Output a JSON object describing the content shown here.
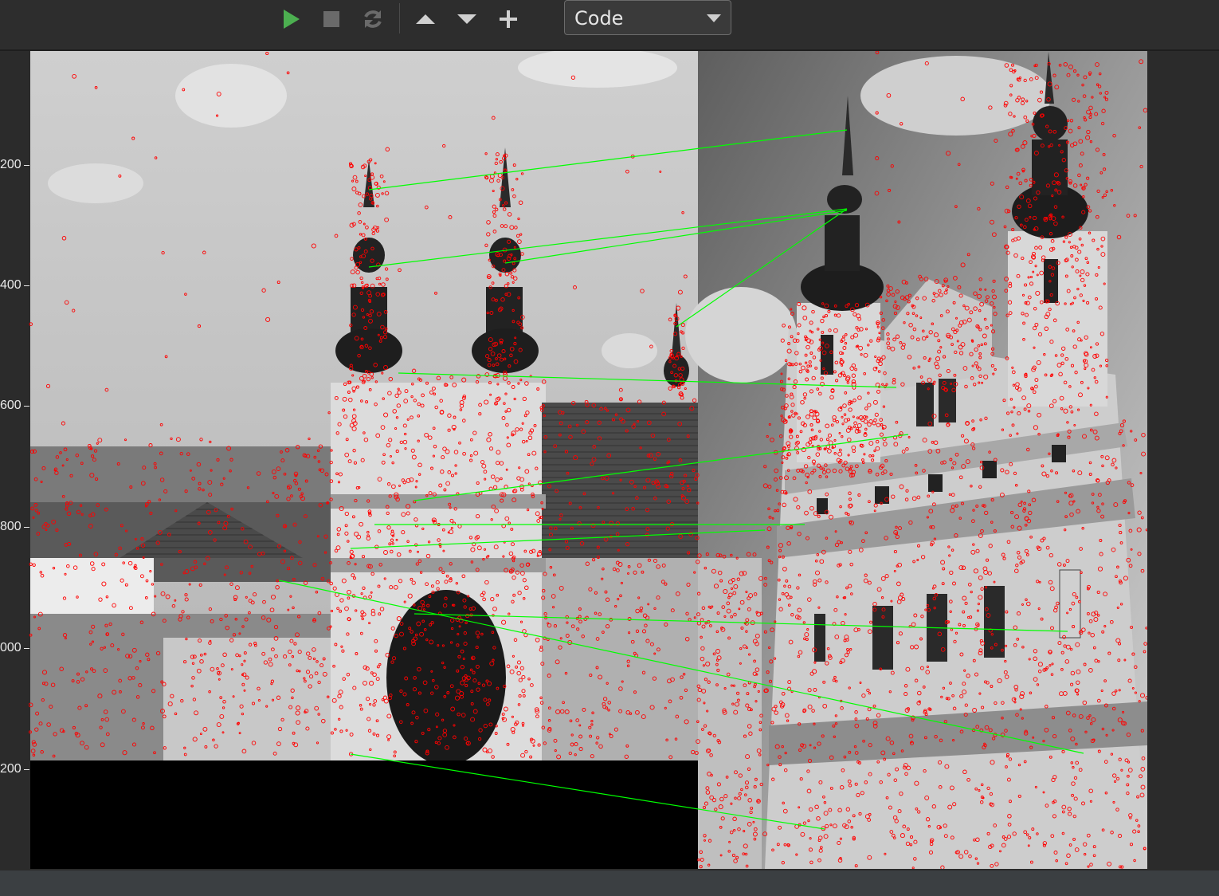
{
  "toolbar": {
    "run_icon": "play-icon",
    "stop_icon": "stop-icon",
    "restart_icon": "restart-icon",
    "move_up_icon": "arrow-up-icon",
    "move_down_icon": "arrow-down-icon",
    "add_icon": "plus-icon",
    "cell_type_value": "Code",
    "run_color": "#4caf50",
    "icon_color": "#d0d0d0",
    "disabled_color": "#6a6a6a"
  },
  "plot": {
    "y_ticks": [
      "200",
      "400",
      "600",
      "800",
      "000",
      "200"
    ],
    "keypoint_color": "#ff0000",
    "match_color": "#00ff00"
  }
}
